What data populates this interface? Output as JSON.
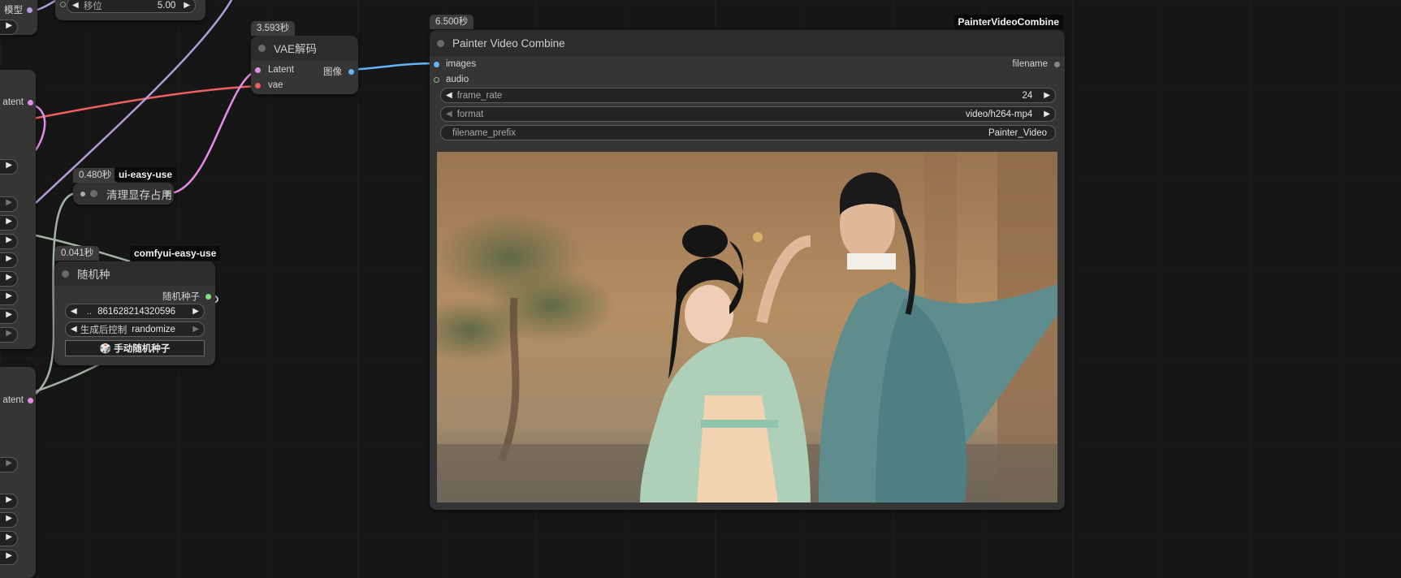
{
  "nodes": {
    "vae_decode": {
      "time": "3.593秒",
      "title": "VAE解码",
      "inputs": [
        "Latent",
        "vae"
      ],
      "output": "图像"
    },
    "painter": {
      "time": "6.500秒",
      "type_tag": "PainterVideoCombine",
      "title": "Painter Video Combine",
      "inputs": [
        "images",
        "audio"
      ],
      "output": "filename",
      "widgets": {
        "frame_rate": {
          "label": "frame_rate",
          "value": "24"
        },
        "format": {
          "label": "format",
          "value": "video/h264-mp4"
        },
        "filename_prefix": {
          "label": "filename_prefix",
          "value": "Painter_Video"
        }
      },
      "preview_icon": "video-preview-image"
    },
    "clear_vram": {
      "time": "0.480秒",
      "tag": "ui-easy-use",
      "title": "清理显存占用"
    },
    "random_seed": {
      "time": "0.041秒",
      "tag": "comfyui-easy-use",
      "title": "随机种",
      "output": "随机种子",
      "seed_prefix": "..",
      "seed_value": "861628214320596",
      "control_label": "生成后控制",
      "control_value": "randomize",
      "button": "🎲 手动随机种子"
    },
    "left_top": {
      "output_label": "模型",
      "widget_label": "移位",
      "widget_value": "5.00"
    },
    "left_mid": {
      "output_label": "atent"
    },
    "left_low": {
      "output_label": "atent"
    }
  },
  "colors": {
    "latent": "#e58ee8",
    "vae": "#ef5f5f",
    "image": "#64b5f6",
    "model": "#b19cd9",
    "generic": "#a3b3a3",
    "canvas": "#161616",
    "node": "#353535"
  }
}
